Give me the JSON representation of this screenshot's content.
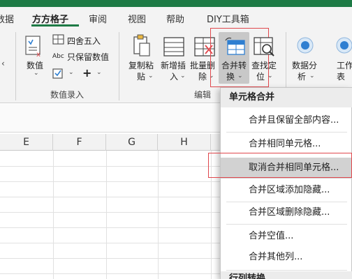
{
  "tabs": [
    {
      "label": "数据",
      "active": false
    },
    {
      "label": "方方格子",
      "active": true
    },
    {
      "label": "审阅",
      "active": false
    },
    {
      "label": "视图",
      "active": false
    },
    {
      "label": "帮助",
      "active": false
    },
    {
      "label": "DIY工具箱",
      "active": false
    }
  ],
  "ribbon": {
    "number_value": {
      "line1": "数值",
      "caret": "⌄"
    },
    "round": "四舍五入",
    "keep_number": "只保留数值",
    "abc_prefix": "Abc",
    "plus": "+",
    "group_numeric": "数值录入",
    "copy_paste": {
      "line1": "复制粘",
      "line2": "贴"
    },
    "add_insert": {
      "line1": "新增插",
      "line2": "入"
    },
    "batch_delete": {
      "line1": "批量删",
      "line2": "除"
    },
    "merge_convert": {
      "line1": "合并转",
      "line2": "换"
    },
    "find_locate": {
      "line1": "查找定",
      "line2": "位"
    },
    "group_edit": "编辑",
    "data_analysis": {
      "line1": "数据分",
      "line2": "析"
    },
    "worksheet": {
      "line1": "工作",
      "line2": "表"
    }
  },
  "columns": [
    "E",
    "F",
    "G",
    "H"
  ],
  "menu": {
    "header": "单元格合并",
    "items": [
      {
        "label": "合并且保留全部内容...",
        "highlighted": false
      },
      {
        "label": "合并相同单元格...",
        "highlighted": false
      },
      {
        "label": "取消合并相同单元格...",
        "highlighted": true
      },
      {
        "label": "合并区域添加隐藏...",
        "highlighted": false
      },
      {
        "label": "合并区域删除隐藏...",
        "highlighted": false
      },
      {
        "label": "合并空值...",
        "highlighted": false
      },
      {
        "label": "合并其他列...",
        "highlighted": false
      }
    ],
    "footer_partial": "行列转换"
  },
  "colors": {
    "accent_green": "#1d7a45",
    "highlight_red": "#e0474c",
    "icon_blue": "#2f7fd1"
  }
}
